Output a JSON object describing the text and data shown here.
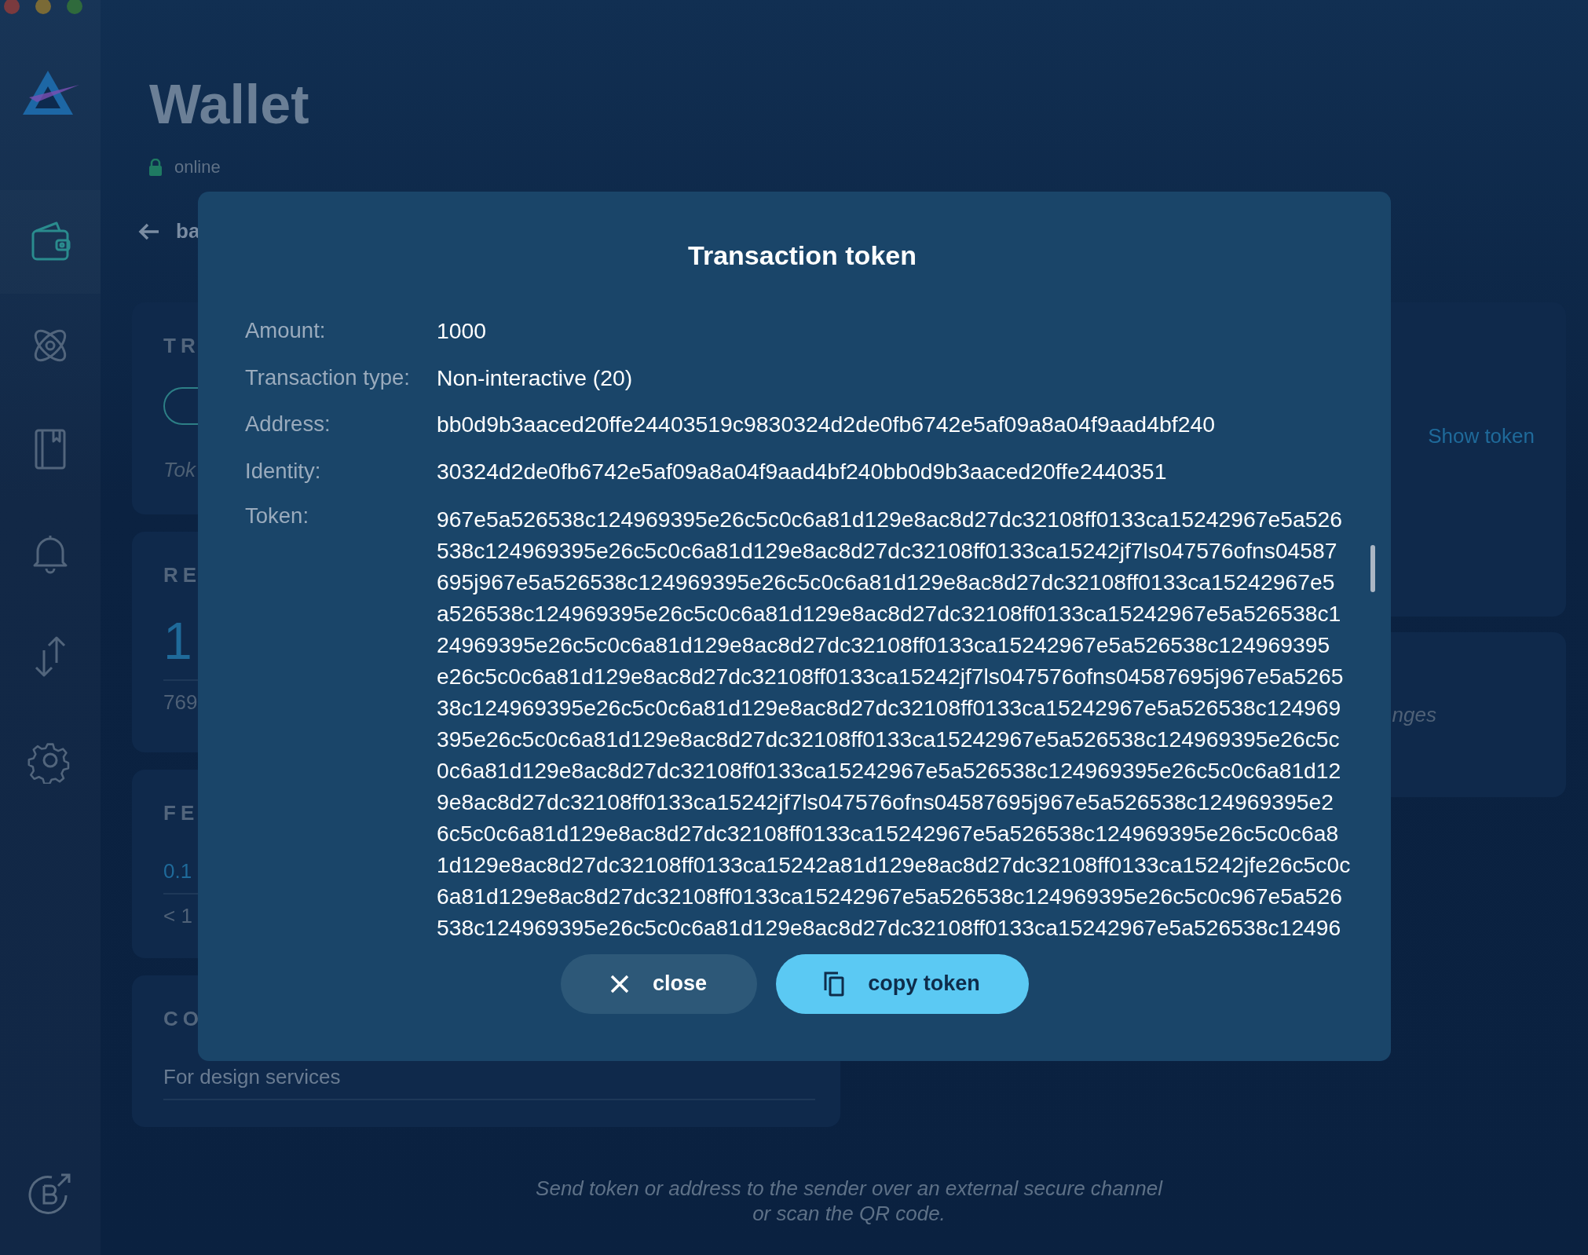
{
  "sidebar": {
    "items": [
      {
        "kind": "wallet",
        "selected": true
      },
      {
        "kind": "atom",
        "selected": false
      },
      {
        "kind": "book",
        "selected": false
      },
      {
        "kind": "bell",
        "selected": false
      },
      {
        "kind": "transfer",
        "selected": false
      },
      {
        "kind": "gear",
        "selected": false
      }
    ]
  },
  "header": {
    "title": "Wallet",
    "status": "online"
  },
  "back_label": "ba",
  "cards": [
    {
      "kind": "input",
      "title": "TR",
      "placeholder": "Tok"
    },
    {
      "kind": "amount",
      "title": "RE",
      "value": "1",
      "subvalue": "769"
    },
    {
      "kind": "fee",
      "title": "FE",
      "value": "0.1",
      "subvalue": "< 1"
    },
    {
      "kind": "comment",
      "title": "CO",
      "value": "For design services"
    }
  ],
  "right_cards": [
    {
      "kind": "link",
      "text": "Show token"
    },
    {
      "kind": "note",
      "text": "nges"
    }
  ],
  "modal": {
    "title": "Transaction token",
    "fields": [
      {
        "label": "Amount:",
        "value": "1000"
      },
      {
        "label": "Transaction type:",
        "value": "Non-interactive (20)"
      },
      {
        "label": "Address:",
        "value": "bb0d9b3aaced20ffe24403519c9830324d2de0fb6742e5af09a8a04f9aad4bf240"
      },
      {
        "label": "Identity:",
        "value": "30324d2de0fb6742e5af09a8a04f9aad4bf240bb0d9b3aaced20ffe2440351"
      }
    ],
    "token_label": "Token:",
    "token_lines": [
      "967e5a526538c124969395e26c5c0c6a81d129e8ac8d27dc32108ff0133ca15242967e5a526",
      "538c124969395e26c5c0c6a81d129e8ac8d27dc32108ff0133ca15242jf7ls047576ofns04587",
      "695j967e5a526538c124969395e26c5c0c6a81d129e8ac8d27dc32108ff0133ca15242967e5",
      "a526538c124969395e26c5c0c6a81d129e8ac8d27dc32108ff0133ca15242967e5a526538c1",
      "24969395e26c5c0c6a81d129e8ac8d27dc32108ff0133ca15242967e5a526538c124969395",
      "e26c5c0c6a81d129e8ac8d27dc32108ff0133ca15242jf7ls047576ofns04587695j967e5a5265",
      "38c124969395e26c5c0c6a81d129e8ac8d27dc32108ff0133ca15242967e5a526538c124969",
      "395e26c5c0c6a81d129e8ac8d27dc32108ff0133ca15242967e5a526538c124969395e26c5c",
      "0c6a81d129e8ac8d27dc32108ff0133ca15242967e5a526538c124969395e26c5c0c6a81d12",
      "9e8ac8d27dc32108ff0133ca15242jf7ls047576ofns04587695j967e5a526538c124969395e2",
      "6c5c0c6a81d129e8ac8d27dc32108ff0133ca15242967e5a526538c124969395e26c5c0c6a8",
      "1d129e8ac8d27dc32108ff0133ca15242a81d129e8ac8d27dc32108ff0133ca15242jfe26c5c0c",
      "6a81d129e8ac8d27dc32108ff0133ca15242967e5a526538c124969395e26c5c0c967e5a526",
      "538c124969395e26c5c0c6a81d129e8ac8d27dc32108ff0133ca15242967e5a526538c12496"
    ],
    "buttons": [
      {
        "kind": "close",
        "label": "close"
      },
      {
        "kind": "copy",
        "label": "copy token"
      }
    ]
  },
  "footer_lines": [
    "Send token or address to the sender over an external secure channel",
    "or scan the QR code."
  ]
}
